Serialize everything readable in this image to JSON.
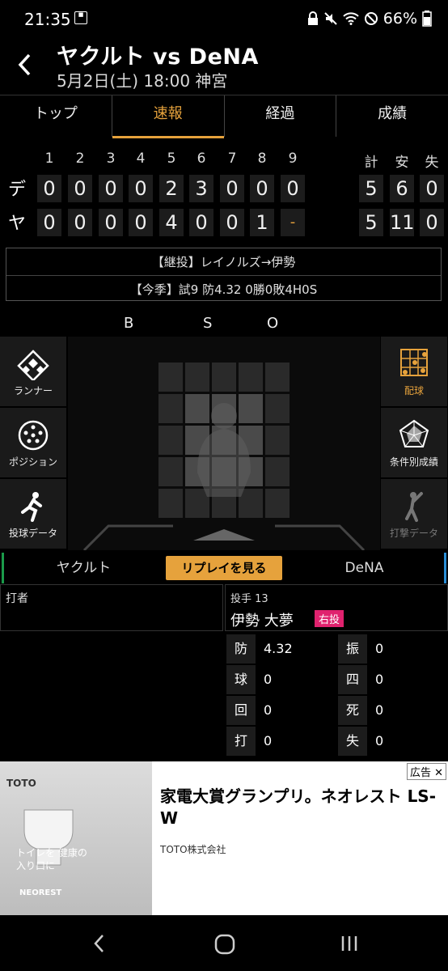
{
  "status": {
    "time": "21:35",
    "battery": "66%"
  },
  "header": {
    "title": "ヤクルト vs DeNA",
    "subtitle": "5月2日(土) 18:00 神宮"
  },
  "tabs": [
    "トップ",
    "速報",
    "経過",
    "成績"
  ],
  "scoreboard": {
    "innings": [
      "1",
      "2",
      "3",
      "4",
      "5",
      "6",
      "7",
      "8",
      "9"
    ],
    "totals_headers": [
      "計",
      "安",
      "失"
    ],
    "rows": [
      {
        "team": "デ",
        "scores": [
          "0",
          "0",
          "0",
          "0",
          "2",
          "3",
          "0",
          "0",
          "0"
        ],
        "totals": [
          "5",
          "6",
          "0"
        ]
      },
      {
        "team": "ヤ",
        "scores": [
          "0",
          "0",
          "0",
          "0",
          "4",
          "0",
          "0",
          "1",
          "-"
        ],
        "totals": [
          "5",
          "11",
          "0"
        ]
      }
    ]
  },
  "info": {
    "line1": "【継投】レイノルズ→伊勢",
    "line2": "【今季】試9 防4.32 0勝0敗4H0S"
  },
  "bso": [
    "B",
    "S",
    "O"
  ],
  "left_buttons": [
    "ランナー",
    "ポジション",
    "投球データ"
  ],
  "right_buttons": [
    "配球",
    "条件別成績",
    "打撃データ"
  ],
  "teambar": {
    "home": "ヤクルト",
    "replay": "リプレイを見る",
    "away": "DeNA"
  },
  "batter": {
    "label": "打者"
  },
  "pitcher": {
    "label": "投手 13",
    "name": "伊勢 大夢",
    "hand": "右投"
  },
  "pitcher_stats": [
    {
      "k1": "防",
      "v1": "4.32",
      "k2": "振",
      "v2": "0"
    },
    {
      "k1": "球",
      "v1": "0",
      "k2": "四",
      "v2": "0"
    },
    {
      "k1": "回",
      "v1": "0",
      "k2": "死",
      "v2": "0"
    },
    {
      "k1": "打",
      "v1": "0",
      "k2": "失",
      "v2": "0"
    }
  ],
  "ad": {
    "tag": "広告",
    "title": "家電大賞グランプリ。ネオレスト LS-W",
    "advertiser": "TOTO株式会社",
    "img_brand": "TOTO",
    "img_text": "トイレを 健康の入り口に",
    "img_product": "NEOREST"
  }
}
